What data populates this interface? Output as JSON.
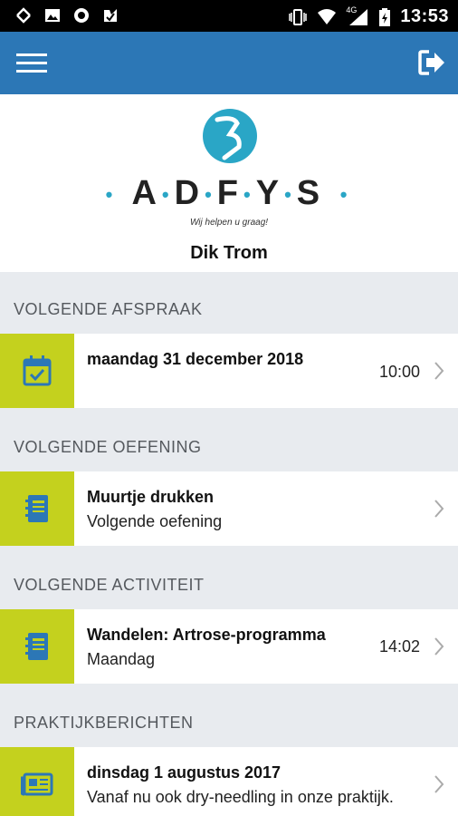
{
  "status_bar": {
    "time": "13:53",
    "network": "4G"
  },
  "logo": {
    "letters": [
      "A",
      "D",
      "F",
      "Y",
      "S"
    ],
    "tagline": "Wij helpen u graag!"
  },
  "user": {
    "name": "Dik Trom"
  },
  "sections": {
    "appointment": {
      "heading": "VOLGENDE AFSPRAAK",
      "title": "maandag 31 december 2018",
      "time": "10:00",
      "icon": "calendar-check-icon"
    },
    "exercise": {
      "heading": "VOLGENDE OEFENING",
      "title": "Muurtje drukken",
      "subtitle": "Volgende oefening",
      "icon": "notebook-icon"
    },
    "activity": {
      "heading": "VOLGENDE ACTIVITEIT",
      "title": "Wandelen: Artrose-programma",
      "subtitle": "Maandag",
      "time": "14:02",
      "icon": "notebook-icon"
    },
    "messages": {
      "heading": "PRAKTIJKBERICHTEN",
      "title": "dinsdag 1 augustus 2017",
      "subtitle": "Vanaf nu ook dry-needling in onze praktijk.",
      "icon": "newspaper-icon"
    }
  },
  "colors": {
    "app_bar": "#2c77b6",
    "accent": "#c4d11e",
    "background": "#e8ebef",
    "logo_dot": "#2aa6c6"
  }
}
